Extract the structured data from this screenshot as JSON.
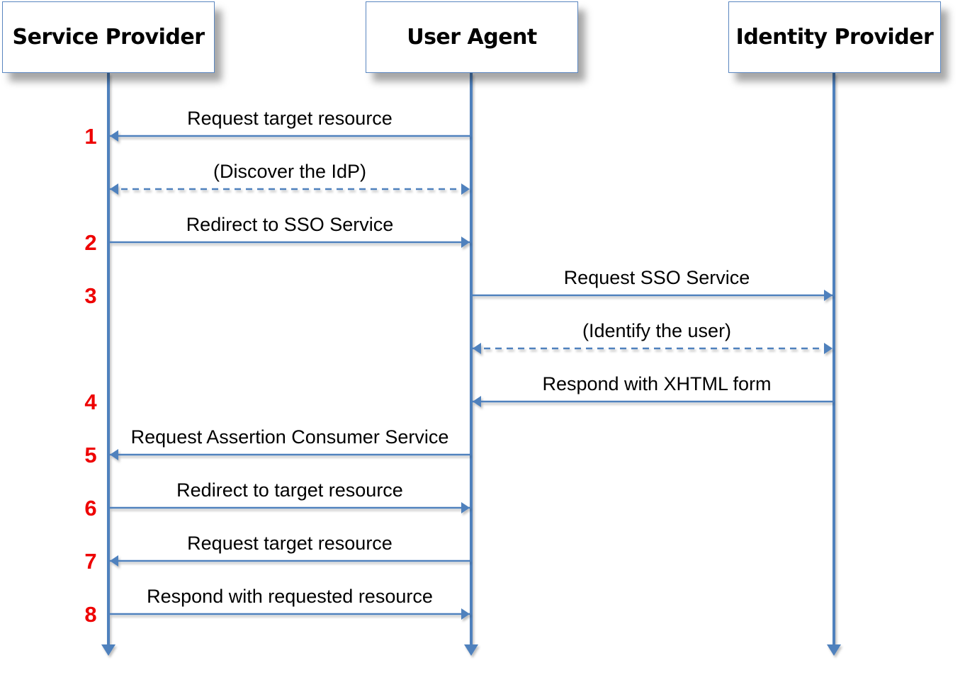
{
  "diagram": {
    "type": "sequence-diagram",
    "line_color": "#4f81bd",
    "step_color": "#ee0000",
    "actors": [
      {
        "id": "sp",
        "label": "Service Provider"
      },
      {
        "id": "ua",
        "label": "User Agent"
      },
      {
        "id": "idp",
        "label": "Identity Provider"
      }
    ],
    "messages": [
      {
        "step": "1",
        "from": "ua",
        "to": "sp",
        "label": "Request target resource",
        "style": "solid"
      },
      {
        "step": "",
        "from": "sp",
        "to": "ua",
        "label": "(Discover the IdP)",
        "style": "dashed",
        "bidirectional": true
      },
      {
        "step": "2",
        "from": "sp",
        "to": "ua",
        "label": "Redirect to SSO Service",
        "style": "solid"
      },
      {
        "step": "3",
        "from": "ua",
        "to": "idp",
        "label": "Request SSO Service",
        "style": "solid"
      },
      {
        "step": "",
        "from": "ua",
        "to": "idp",
        "label": "(Identify the user)",
        "style": "dashed",
        "bidirectional": true
      },
      {
        "step": "4",
        "from": "idp",
        "to": "ua",
        "label": "Respond with XHTML form",
        "style": "solid"
      },
      {
        "step": "5",
        "from": "ua",
        "to": "sp",
        "label": "Request Assertion Consumer Service",
        "style": "solid"
      },
      {
        "step": "6",
        "from": "sp",
        "to": "ua",
        "label": "Redirect to target resource",
        "style": "solid"
      },
      {
        "step": "7",
        "from": "ua",
        "to": "sp",
        "label": "Request target resource",
        "style": "solid"
      },
      {
        "step": "8",
        "from": "sp",
        "to": "ua",
        "label": "Respond with requested resource",
        "style": "solid"
      }
    ]
  }
}
